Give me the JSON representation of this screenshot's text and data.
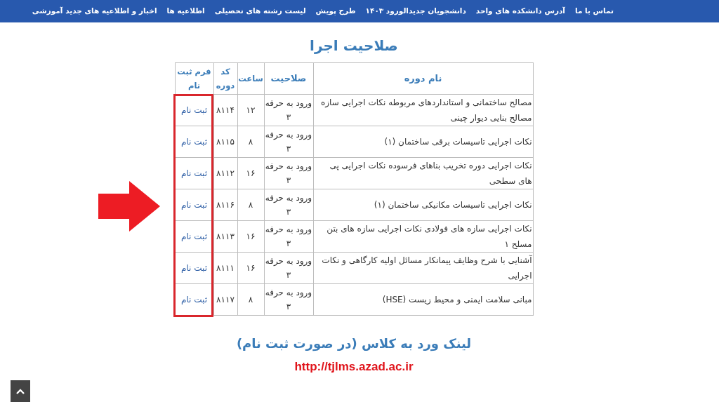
{
  "nav": {
    "items": [
      "تماس با ما",
      "آدرس دانشکده های واحد",
      "دانشجویان جدیدالورود ۱۴۰۳",
      "طرح پویش",
      "لیست رشته های تحصیلی",
      "اطلاعیه ها",
      "اخبار و اطلاعیه های جدید آموزشی"
    ]
  },
  "title": "صلاحیت اجرا",
  "table": {
    "columns": [
      "نام دوره",
      "صلاحیت",
      "ساعت",
      "کد دوره",
      "فرم ثبت نام"
    ],
    "rows": [
      {
        "course": "مصالح ساختمانی و استانداردهای مربوطه نکات اجرایی سازه مصالح بنایی دیوار چینی",
        "qualification": "ورود به حرفه ۳",
        "hours": "۱۲",
        "code": "۸۱۱۴",
        "register": "ثبت نام"
      },
      {
        "course": "نکات اجرایی تاسیسات برقی ساختمان (۱)",
        "qualification": "ورود به حرفه ۳",
        "hours": "۸",
        "code": "۸۱۱۵",
        "register": "ثبت نام"
      },
      {
        "course": "نکات اجرایی دوره تخریب بناهای فرسوده نکات اجرایی پی های سطحی",
        "qualification": "ورود به حرفه ۳",
        "hours": "۱۶",
        "code": "۸۱۱۲",
        "register": "ثبت نام"
      },
      {
        "course": "نکات اجرایی تاسیسات مکانیکی ساختمان (۱)",
        "qualification": "ورود به حرفه ۳",
        "hours": "۸",
        "code": "۸۱۱۶",
        "register": "ثبت نام"
      },
      {
        "course": "نکات اجرایی سازه های فولادی نکات اجرایی سازه های بتن مسلح ۱",
        "qualification": "ورود به حرفه ۳",
        "hours": "۱۶",
        "code": "۸۱۱۳",
        "register": "ثبت نام"
      },
      {
        "course": "آشنایی با شرح وظایف پیمانکار مسائل اولیه کارگاهی و نکات اجرایی",
        "qualification": "ورود به حرفه ۳",
        "hours": "۱۶",
        "code": "۸۱۱۱",
        "register": "ثبت نام"
      },
      {
        "course": "مبانی سلامت ایمنی و محیط زیست (HSE)",
        "qualification": "ورود به حرفه ۳",
        "hours": "۸",
        "code": "۸۱۱۷",
        "register": "ثبت نام"
      }
    ]
  },
  "class_link": {
    "heading": "لینک ورد به کلاس (در صورت ثبت نام)",
    "url": "http://tjlms.azad.ac.ir"
  }
}
